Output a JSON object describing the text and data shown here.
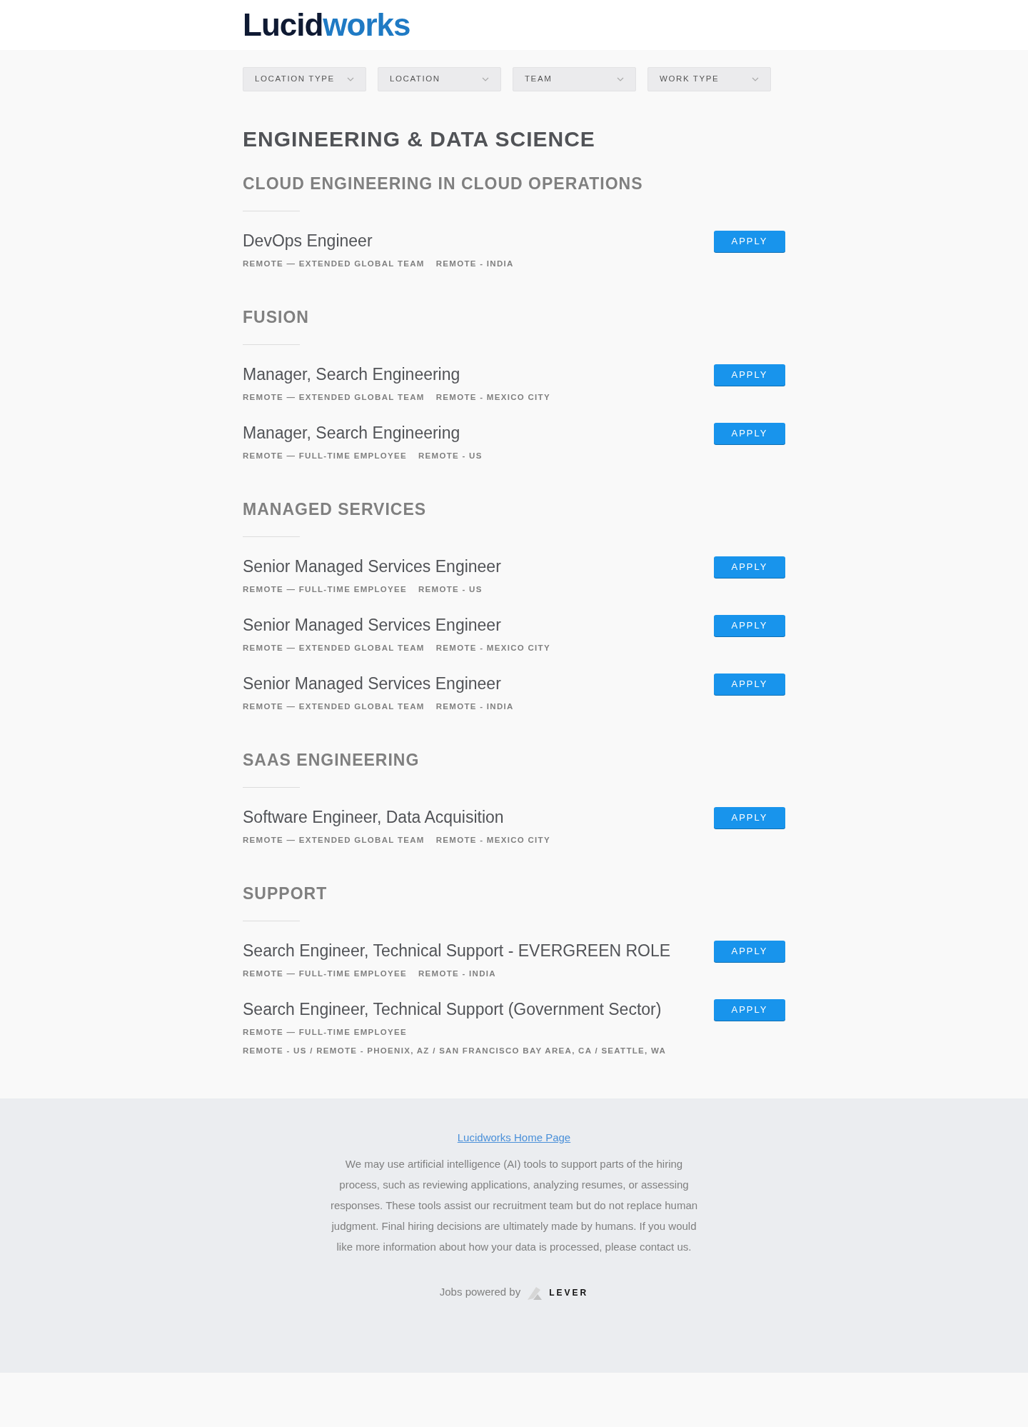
{
  "header": {
    "logo": [
      "Lucid",
      "works"
    ]
  },
  "filters": [
    {
      "label": "LOCATION TYPE"
    },
    {
      "label": "LOCATION"
    },
    {
      "label": "TEAM"
    },
    {
      "label": "WORK TYPE"
    }
  ],
  "department": "ENGINEERING & DATA SCIENCE",
  "teams": [
    {
      "name": "CLOUD ENGINEERING IN CLOUD OPERATIONS",
      "jobs": [
        {
          "title": "DevOps Engineer",
          "tags": [
            "REMOTE — EXTENDED GLOBAL TEAM",
            "REMOTE - INDIA"
          ],
          "button": "APPLY"
        }
      ]
    },
    {
      "name": "FUSION",
      "jobs": [
        {
          "title": "Manager, Search Engineering",
          "tags": [
            "REMOTE — EXTENDED GLOBAL TEAM",
            "REMOTE - MEXICO CITY"
          ],
          "button": "APPLY"
        },
        {
          "title": "Manager, Search Engineering",
          "tags": [
            "REMOTE — FULL-TIME EMPLOYEE",
            "REMOTE - US"
          ],
          "button": "APPLY"
        }
      ]
    },
    {
      "name": "MANAGED SERVICES",
      "jobs": [
        {
          "title": "Senior Managed Services Engineer",
          "tags": [
            "REMOTE — FULL-TIME EMPLOYEE",
            "REMOTE - US"
          ],
          "button": "APPLY"
        },
        {
          "title": "Senior Managed Services Engineer",
          "tags": [
            "REMOTE — EXTENDED GLOBAL TEAM",
            "REMOTE - MEXICO CITY"
          ],
          "button": "APPLY"
        },
        {
          "title": "Senior Managed Services Engineer",
          "tags": [
            "REMOTE — EXTENDED GLOBAL TEAM",
            "REMOTE - INDIA"
          ],
          "button": "APPLY"
        }
      ]
    },
    {
      "name": "SAAS ENGINEERING",
      "jobs": [
        {
          "title": "Software Engineer, Data Acquisition",
          "tags": [
            "REMOTE — EXTENDED GLOBAL TEAM",
            "REMOTE - MEXICO CITY"
          ],
          "button": "APPLY"
        }
      ]
    },
    {
      "name": "SUPPORT",
      "jobs": [
        {
          "title": "Search Engineer, Technical Support - EVERGREEN ROLE",
          "tags": [
            "REMOTE — FULL-TIME EMPLOYEE",
            "REMOTE - INDIA"
          ],
          "button": "APPLY"
        },
        {
          "title": "Search Engineer, Technical Support (Government Sector)",
          "tags": [
            "REMOTE — FULL-TIME EMPLOYEE",
            "REMOTE - US / REMOTE - PHOENIX, AZ / SAN FRANCISCO BAY AREA, CA / SEATTLE, WA"
          ],
          "button": "APPLY"
        }
      ]
    }
  ],
  "footer": {
    "link": "Lucidworks Home Page",
    "notice": "We may use artificial intelligence (AI) tools to support parts of the hiring process, such as reviewing applications, analyzing resumes, or assessing responses. These tools assist our recruitment team but do not replace human judgment. Final hiring decisions are ultimately made by humans. If you would like more information about how your data is processed, please contact us.",
    "powered_by": "Jobs powered by",
    "brand": "LEVER"
  }
}
